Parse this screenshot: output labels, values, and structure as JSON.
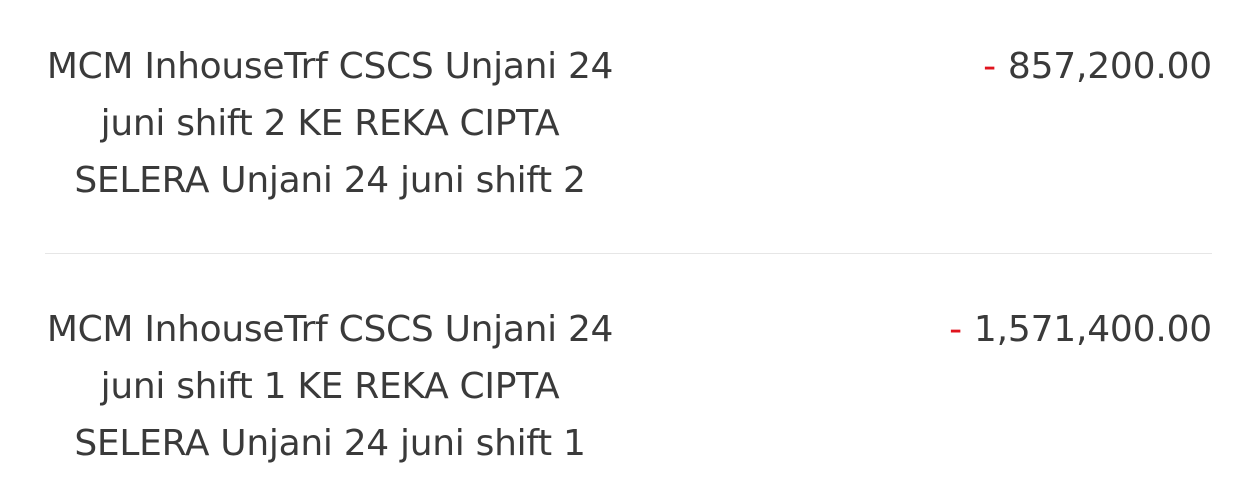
{
  "colors": {
    "text": "#3a3a3a",
    "debit_sign": "#e0141e",
    "divider": "#e6e6e6",
    "background": "#ffffff"
  },
  "transactions": [
    {
      "description": "MCM InhouseTrf CSCS Unjani 24 juni shift 2 KE REKA CIPTA SELERA Unjani 24 juni shift 2",
      "sign": "-",
      "amount": "857,200.00"
    },
    {
      "description": "MCM InhouseTrf CSCS Unjani 24 juni shift 1 KE REKA CIPTA SELERA Unjani 24 juni shift 1",
      "sign": "-",
      "amount": "1,571,400.00"
    }
  ]
}
